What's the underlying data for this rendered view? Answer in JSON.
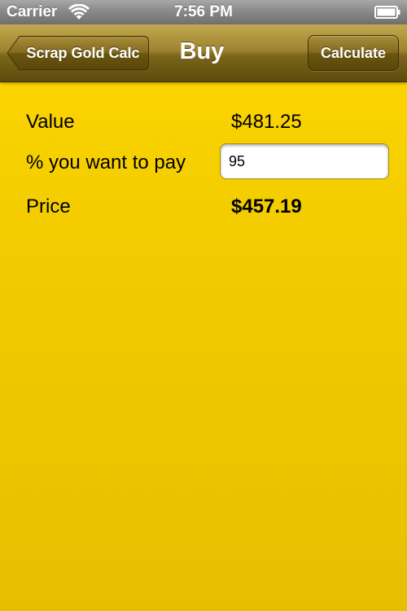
{
  "status_bar": {
    "carrier": "Carrier",
    "time": "7:56 PM",
    "wifi_icon": "wifi-icon",
    "battery_icon": "battery-icon"
  },
  "nav_bar": {
    "back_label": "Scrap Gold Calc",
    "title": "Buy",
    "calculate_label": "Calculate"
  },
  "form": {
    "value_label": "Value",
    "value_amount": "$481.25",
    "pay_label": "% you want to pay",
    "pay_input_value": "95",
    "price_label": "Price",
    "price_amount": "$457.19"
  },
  "colors": {
    "background": "#f2cb00",
    "nav_bar": "#7c661c",
    "status_bar": "#8a8a8a"
  }
}
